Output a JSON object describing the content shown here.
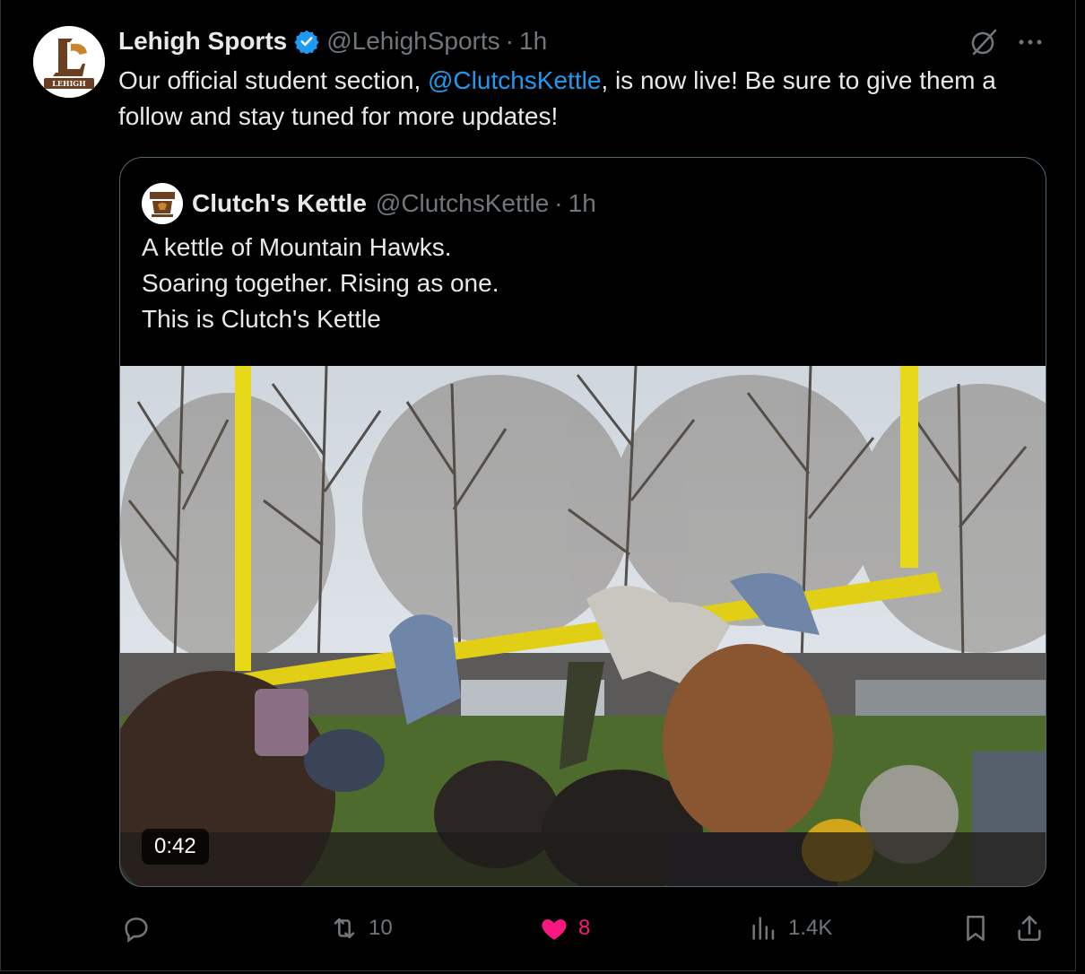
{
  "tweet": {
    "author_name": "Lehigh Sports",
    "author_handle": "@LehighSports",
    "separator": "·",
    "time": "1h",
    "avatar_caption": "LEHIGH",
    "text_before": "Our official student section, ",
    "mention": "@ClutchsKettle",
    "text_after": ", is now live! Be sure to give them a follow and stay tuned for more updates!"
  },
  "quote": {
    "author_name": "Clutch's Kettle",
    "author_handle": "@ClutchsKettle",
    "separator": "·",
    "time": "1h",
    "avatar_caption": "CLUTCH'S KETTLE",
    "lines": [
      "A kettle of Mountain Hawks.",
      "Soaring together. Rising as one.",
      "This is Clutch's Kettle"
    ],
    "video_duration": "0:42"
  },
  "actions": {
    "replies": "",
    "retweets": "10",
    "likes": "8",
    "views": "1.4K"
  },
  "colors": {
    "background": "#000000",
    "text": "#e7e9ea",
    "muted": "#71767b",
    "accent": "#1d9bf0",
    "like": "#f91880",
    "verified": "#1d9bf0",
    "goalpost": "#e8d81a"
  },
  "icons": [
    "verified-badge-icon",
    "grok-icon",
    "more-icon",
    "reply-icon",
    "retweet-icon",
    "like-icon",
    "views-icon",
    "bookmark-icon",
    "share-icon"
  ]
}
